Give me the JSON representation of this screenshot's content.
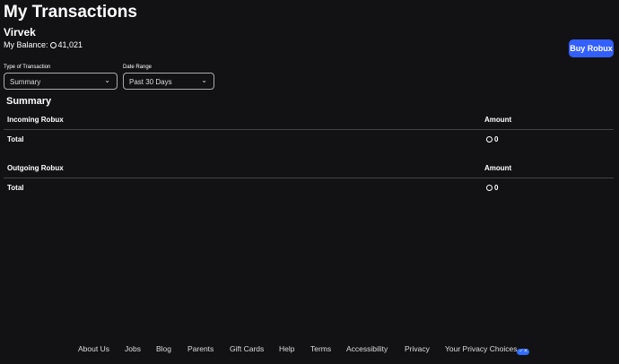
{
  "title": "My Transactions",
  "username": "Virvek",
  "balance_label": "My Balance:",
  "balance": "41,021",
  "buy_label": "Buy Robux",
  "type_label": "Type of Transaction",
  "type_value": "Summary",
  "date_label": "Date Range",
  "date_value": "Past 30 Days",
  "summary_title": "Summary",
  "incoming": {
    "header": "Incoming Robux",
    "amount_header": "Amount",
    "total_label": "Total",
    "total": "0"
  },
  "outgoing": {
    "header": "Outgoing Robux",
    "amount_header": "Amount",
    "total_label": "Total",
    "total": "0"
  },
  "footer": [
    "About Us",
    "Jobs",
    "Blog",
    "Parents",
    "Gift Cards",
    "Help",
    "Terms",
    "Accessibility",
    "Privacy",
    "Your Privacy Choices"
  ]
}
